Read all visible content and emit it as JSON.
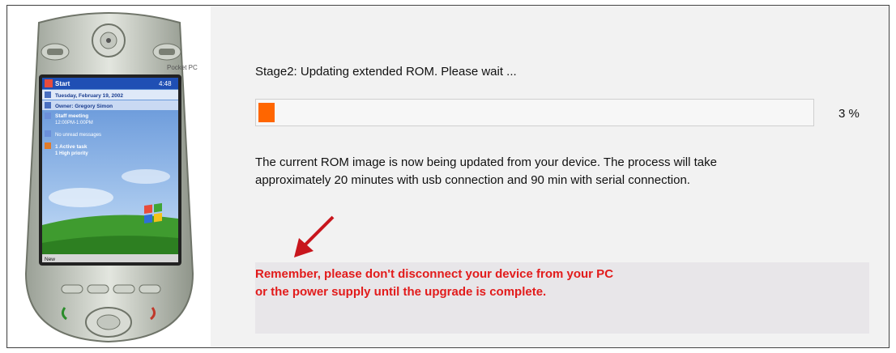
{
  "device": {
    "brand": "Pocket PC",
    "start_label": "Start",
    "clock": "4:48",
    "date_line": "Tuesday, February 19, 2002",
    "owner_line": "Owner: Gregory Simon",
    "meeting_title": "Staff meeting",
    "meeting_time": "12:00PM-1:00PM",
    "messages": "No unread messages",
    "tasks_line1": "1 Active task",
    "tasks_line2": "1 High priority",
    "menu_new": "New"
  },
  "stage_text": "Stage2: Updating extended ROM. Please wait ...",
  "progress": {
    "value": 3,
    "label": "3  %"
  },
  "description": [
    "The current ROM image is now being updated from your device. The process will take",
    "approximately 20 minutes with usb connection and 90 min with serial connection."
  ],
  "warning": [
    "Remember, please don't disconnect your device from your PC",
    "or the power supply until the upgrade is complete."
  ],
  "colors": {
    "progress_fill": "#ff6600",
    "warning_text": "#e21b1b",
    "arrow": "#c8161d"
  }
}
